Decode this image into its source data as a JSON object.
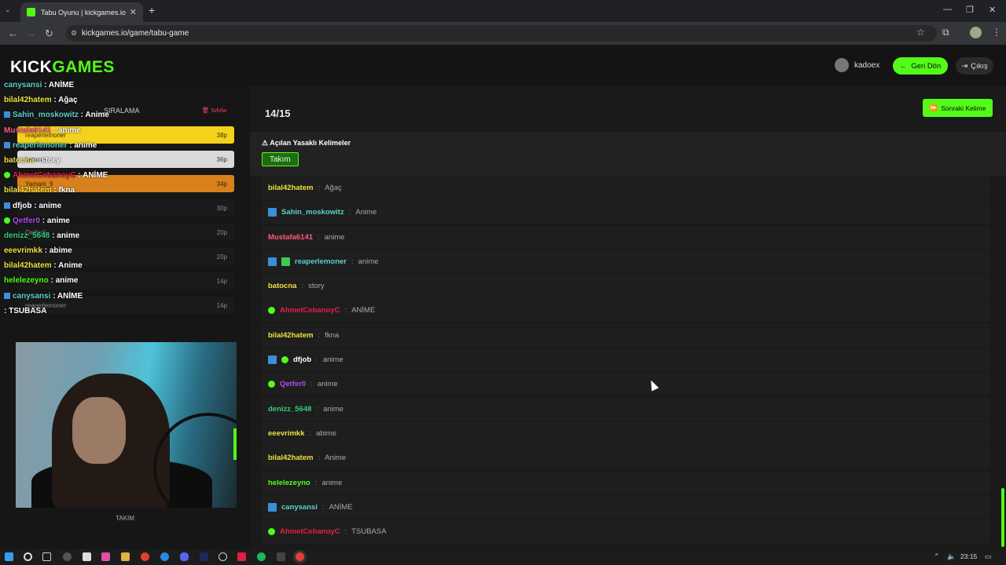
{
  "browser": {
    "tab_title": "Tabu Oyunu | kickgames.io",
    "url": "kickgames.io/game/tabu-game",
    "new_tab": "+",
    "tab_close": "✕"
  },
  "header": {
    "logo_kick": "KICK",
    "logo_games": "GAMES",
    "username": "kadoex",
    "back_label": "Geri Dön",
    "logout_label": "Çıkış"
  },
  "ranking": {
    "title": "SIRALAMA",
    "reset_label": "Sıfırla",
    "rows": [
      {
        "name": "reaperlemoner",
        "points": "38p",
        "bg": "#f4d21c",
        "fg": "#3a3000"
      },
      {
        "name": "batocna",
        "points": "36p",
        "bg": "#d9d9d9",
        "fg": "#333"
      },
      {
        "name": "Yamani_9",
        "points": "34p",
        "bg": "#d8801c",
        "fg": "#3a1e00"
      },
      {
        "name": "",
        "points": "30p",
        "bg": "#1a1a1a",
        "fg": "#888"
      },
      {
        "name": "Qetfer0",
        "points": "20p",
        "bg": "#1a1a1a",
        "fg": "#888"
      },
      {
        "name": "",
        "points": "20p",
        "bg": "#1a1a1a",
        "fg": "#888"
      },
      {
        "name": "",
        "points": "14p",
        "bg": "#1a1a1a",
        "fg": "#888"
      },
      {
        "name": "reaperlemoner",
        "points": "14p",
        "bg": "#1a1a1a",
        "fg": "#888"
      }
    ]
  },
  "chat_overlay": [
    {
      "user": "canysansi",
      "msg": "ANİME",
      "color": "#5ad2c8",
      "badge": ""
    },
    {
      "user": "bilal42hatem",
      "msg": "Ağaç",
      "color": "#f0e040",
      "badge": ""
    },
    {
      "user": "Sahin_moskowitz",
      "msg": "Anime",
      "color": "#5ad2c8",
      "badge": "blue"
    },
    {
      "user": "Mustafa6141",
      "msg": "anime",
      "color": "#ff5a7a",
      "badge": ""
    },
    {
      "user": "reaperlemoner",
      "msg": "anime",
      "color": "#5ad2c8",
      "badge": "blue"
    },
    {
      "user": "batocna",
      "msg": "story",
      "color": "#f0e040",
      "badge": ""
    },
    {
      "user": "AhmetCebanoyC",
      "msg": "ANİME",
      "color": "#e0204a",
      "badge": "green"
    },
    {
      "user": "bilal42hatem",
      "msg": "fkna",
      "color": "#f0e040",
      "badge": ""
    },
    {
      "user": "dfjob",
      "msg": "anime",
      "color": "#fff",
      "badge": "blue"
    },
    {
      "user": "Qetfer0",
      "msg": "anime",
      "color": "#b04af0",
      "badge": "green"
    },
    {
      "user": "denizz_5648",
      "msg": "anime",
      "color": "#2ad07a",
      "badge": ""
    },
    {
      "user": "eeevrimkk",
      "msg": "abime",
      "color": "#f0e040",
      "badge": ""
    },
    {
      "user": "bilal42hatem",
      "msg": "Anime",
      "color": "#f0e040",
      "badge": ""
    },
    {
      "user": "helelezeyno",
      "msg": "anime",
      "color": "#53fc18",
      "badge": ""
    },
    {
      "user": "canysansi",
      "msg": "ANİME",
      "color": "#5ad2c8",
      "badge": "blue"
    },
    {
      "user": "",
      "msg": "TSUBASA",
      "color": "#e0204a",
      "badge": ""
    }
  ],
  "webcam_label": "TAKIM",
  "game": {
    "counter": "14/15",
    "next_label": "Sonraki Kelime",
    "banned_title": "Açılan Yasaklı Kelimeler",
    "banned_word": "Takım",
    "separator": ":",
    "guesses": [
      {
        "user": "bilal42hatem",
        "msg": "Ağaç",
        "color": "#f0e040",
        "badges": []
      },
      {
        "user": "Sahin_moskowitz",
        "msg": "Anime",
        "color": "#5ad2c8",
        "badges": [
          "blue"
        ]
      },
      {
        "user": "Mustafa6141",
        "msg": "anime",
        "color": "#ff5a7a",
        "badges": []
      },
      {
        "user": "reaperlemoner",
        "msg": "anime",
        "color": "#5ad2c8",
        "badges": [
          "blue",
          "gift"
        ]
      },
      {
        "user": "batocna",
        "msg": "story",
        "color": "#f0e040",
        "badges": []
      },
      {
        "user": "AhmetCebanoyC",
        "msg": "ANİME",
        "color": "#e0204a",
        "badges": [
          "green"
        ]
      },
      {
        "user": "bilal42hatem",
        "msg": "fkna",
        "color": "#f0e040",
        "badges": []
      },
      {
        "user": "dfjob",
        "msg": "anime",
        "color": "#ffffff",
        "badges": [
          "blue",
          "green"
        ]
      },
      {
        "user": "Qetfer0",
        "msg": "anime",
        "color": "#b04af0",
        "badges": [
          "green"
        ]
      },
      {
        "user": "denizz_5648",
        "msg": "anime",
        "color": "#2ad07a",
        "badges": []
      },
      {
        "user": "eeevrimkk",
        "msg": "abime",
        "color": "#f0e040",
        "badges": []
      },
      {
        "user": "bilal42hatem",
        "msg": "Anime",
        "color": "#f0e040",
        "badges": []
      },
      {
        "user": "helelezeyno",
        "msg": "anime",
        "color": "#53fc18",
        "badges": []
      },
      {
        "user": "canysansi",
        "msg": "ANİME",
        "color": "#5ad2c8",
        "badges": [
          "blue"
        ]
      },
      {
        "user": "AhmetCebanoyC",
        "msg": "TSUBASA",
        "color": "#e0204a",
        "badges": [
          "green"
        ]
      }
    ]
  },
  "taskbar": {
    "time": "23:15"
  },
  "colors": {
    "accent": "#53fc18"
  }
}
